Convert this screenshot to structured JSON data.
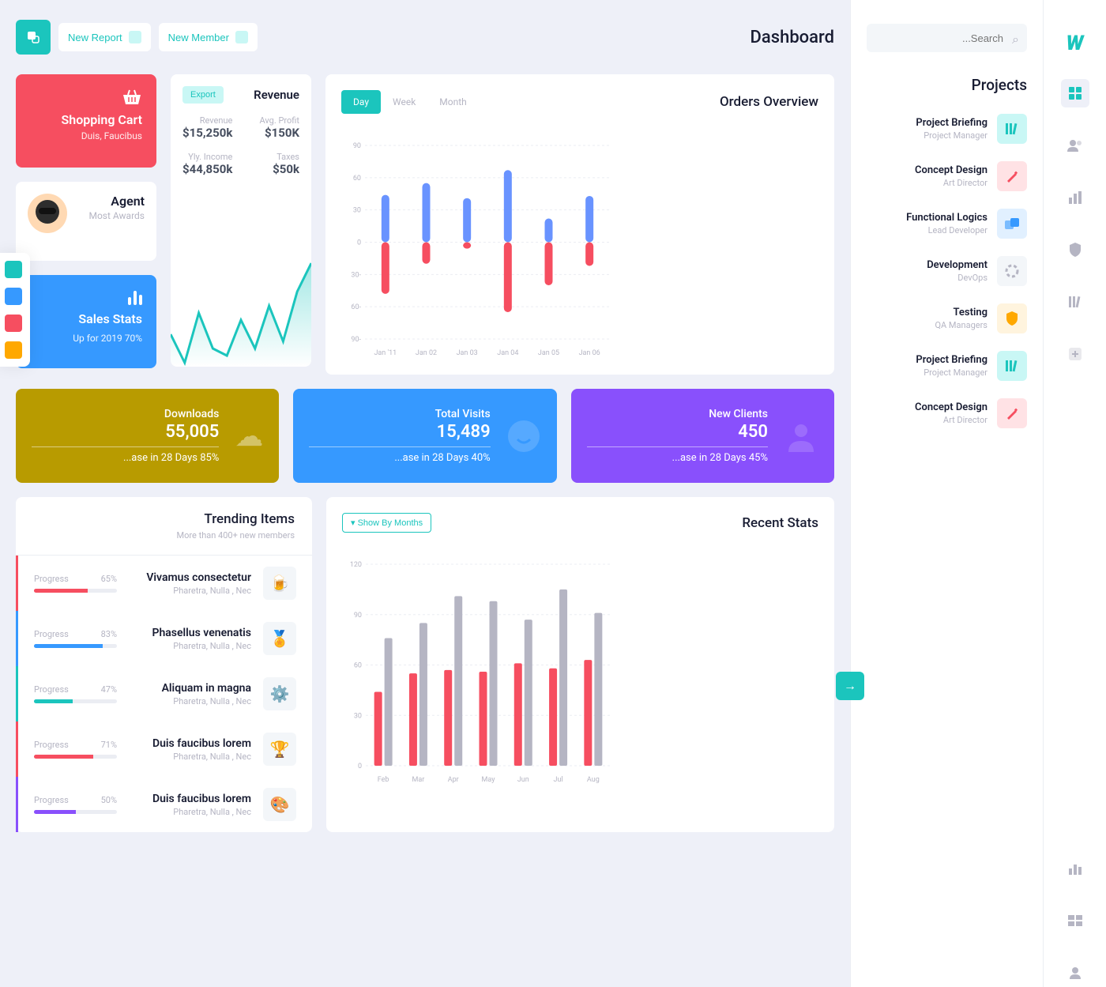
{
  "topbar": {
    "new_report": "New Report",
    "new_member": "New Member",
    "page_title": "Dashboard"
  },
  "shopping": {
    "title": "Shopping Cart",
    "subtitle": "Duis, Faucibus"
  },
  "agent": {
    "title": "Agent",
    "subtitle": "Most Awards"
  },
  "sales": {
    "title": "Sales Stats",
    "subtitle": "Up for 2019 70%"
  },
  "revenue": {
    "title": "Revenue",
    "export": "Export",
    "stats": [
      {
        "label": "Revenue",
        "value": "$15,250k"
      },
      {
        "label": "Avg. Profit",
        "value": "$150K"
      },
      {
        "label": "Yly. Income",
        "value": "$44,850k"
      },
      {
        "label": "Taxes",
        "value": "$50k"
      }
    ]
  },
  "orders": {
    "title": "Orders Overview",
    "tabs": [
      "Day",
      "Week",
      "Month"
    ]
  },
  "stats": [
    {
      "label": "Downloads",
      "value": "55,005",
      "sub": "...ase in 28 Days 85%"
    },
    {
      "label": "Total Visits",
      "value": "15,489",
      "sub": "...ase in 28 Days 40%"
    },
    {
      "label": "New Clients",
      "value": "450",
      "sub": "...ase in 28 Days 45%"
    }
  ],
  "trending": {
    "title": "Trending Items",
    "subtitle": "More than 400+ new members",
    "items": [
      {
        "progress_label": "Progress",
        "pct": "65%",
        "pct_n": 65,
        "title": "Vivamus consectetur",
        "sub": "Pharetra, Nulla , Nec",
        "color": "#f64e60",
        "icon": "🍺"
      },
      {
        "progress_label": "Progress",
        "pct": "83%",
        "pct_n": 83,
        "title": "Phasellus venenatis",
        "sub": "Pharetra, Nulla , Nec",
        "color": "#3699ff",
        "icon": "🏅"
      },
      {
        "progress_label": "Progress",
        "pct": "47%",
        "pct_n": 47,
        "title": "Aliquam in magna",
        "sub": "Pharetra, Nulla , Nec",
        "color": "#1bc5bd",
        "icon": "⚙️"
      },
      {
        "progress_label": "Progress",
        "pct": "71%",
        "pct_n": 71,
        "title": "Duis faucibus lorem",
        "sub": "Pharetra, Nulla , Nec",
        "color": "#f64e60",
        "icon": "🏆"
      },
      {
        "progress_label": "Progress",
        "pct": "50%",
        "pct_n": 50,
        "title": "Duis faucibus lorem",
        "sub": "Pharetra, Nulla , Nec",
        "color": "#8950fc",
        "icon": "🎨"
      }
    ]
  },
  "recent": {
    "title": "Recent Stats",
    "show_btn": "Show By Months"
  },
  "right": {
    "search_placeholder": "...Search",
    "projects_title": "Projects",
    "projects": [
      {
        "title": "Project Briefing",
        "role": "Project Manager",
        "icon_bg": "pi-teal",
        "icon_color": "#1bc5bd"
      },
      {
        "title": "Concept Design",
        "role": "Art Director",
        "icon_bg": "pi-red",
        "icon_color": "#f64e60"
      },
      {
        "title": "Functional Logics",
        "role": "Lead Developer",
        "icon_bg": "pi-blue",
        "icon_color": "#3699ff"
      },
      {
        "title": "Development",
        "role": "DevOps",
        "icon_bg": "pi-white",
        "icon_color": "#b5b5c3"
      },
      {
        "title": "Testing",
        "role": "QA Managers",
        "icon_bg": "pi-yellow",
        "icon_color": "#ffa800"
      },
      {
        "title": "Project Briefing",
        "role": "Project Manager",
        "icon_bg": "pi-teal",
        "icon_color": "#1bc5bd"
      },
      {
        "title": "Concept Design",
        "role": "Art Director",
        "icon_bg": "pi-red",
        "icon_color": "#f64e60"
      }
    ]
  },
  "chart_data": [
    {
      "type": "bar",
      "name": "orders_overview",
      "categories": [
        "Jan '11",
        "Jan 02",
        "Jan 03",
        "Jan 04",
        "Jan 05",
        "Jan 06"
      ],
      "ylim": [
        -90,
        90
      ],
      "yticks": [
        90,
        60,
        30,
        0,
        "30-",
        "60-",
        "90-"
      ],
      "series": [
        {
          "name": "positive",
          "color": "#6993ff",
          "values": [
            44,
            55,
            41,
            67,
            22,
            43
          ]
        },
        {
          "name": "negative",
          "color": "#f64e60",
          "values": [
            -48,
            -20,
            -6,
            -65,
            -40,
            -22
          ]
        }
      ]
    },
    {
      "type": "area",
      "name": "revenue_spark",
      "x": [
        0,
        1,
        2,
        3,
        4,
        5,
        6,
        7,
        8,
        9,
        10
      ],
      "values": [
        40,
        20,
        55,
        30,
        25,
        50,
        30,
        60,
        35,
        70,
        90
      ],
      "color": "#1bc5bd"
    },
    {
      "type": "bar",
      "name": "recent_stats",
      "categories": [
        "Feb",
        "Mar",
        "Apr",
        "May",
        "Jun",
        "Jul",
        "Aug"
      ],
      "ylim": [
        0,
        120
      ],
      "yticks": [
        0,
        30,
        60,
        90,
        120
      ],
      "series": [
        {
          "name": "red",
          "color": "#f64e60",
          "values": [
            44,
            55,
            57,
            56,
            61,
            58,
            63
          ]
        },
        {
          "name": "gray",
          "color": "#b5b5c3",
          "values": [
            76,
            85,
            101,
            98,
            87,
            105,
            91
          ]
        }
      ]
    }
  ]
}
